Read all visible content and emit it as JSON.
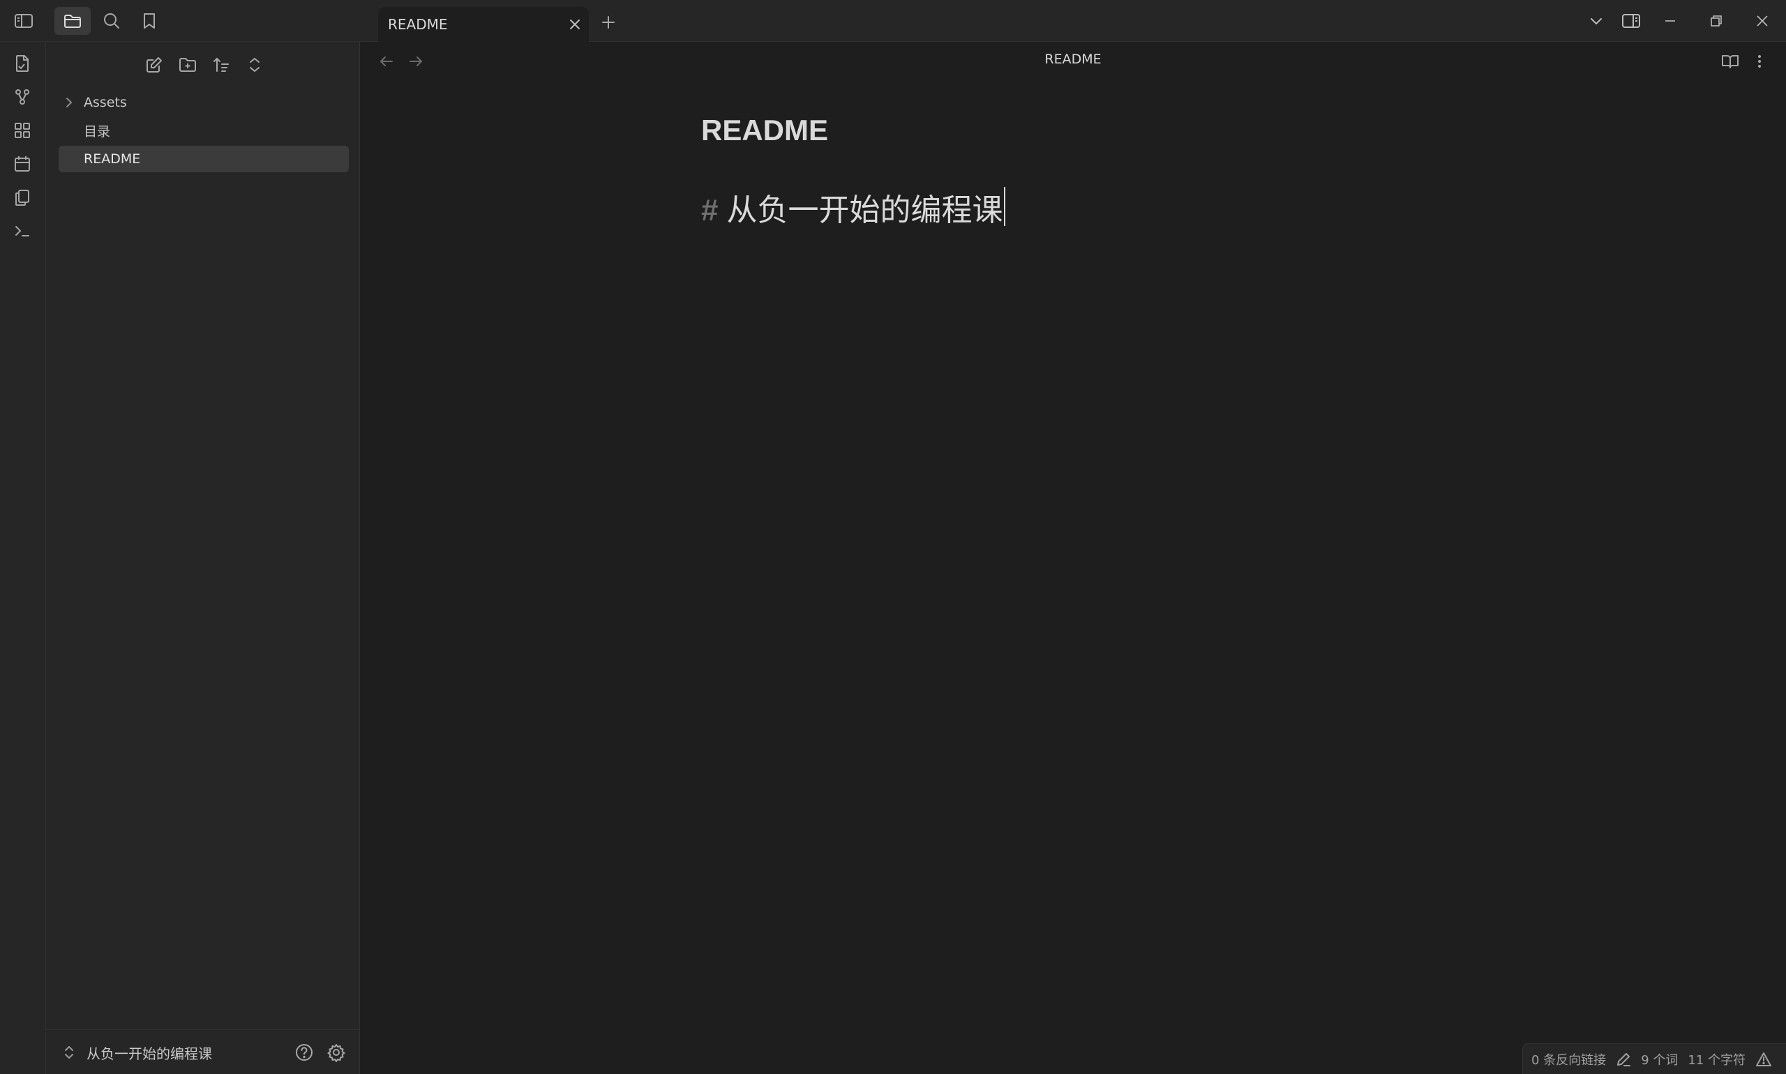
{
  "app": {
    "tab": {
      "title": "README"
    }
  },
  "sidebar": {
    "tree": [
      {
        "label": "Assets",
        "type": "folder"
      },
      {
        "label": "目录",
        "type": "file"
      },
      {
        "label": "README",
        "type": "file",
        "active": true
      }
    ],
    "vault_name": "从负一开始的编程课"
  },
  "editor": {
    "view_title": "README",
    "doc_title": "README",
    "heading_marker": "#",
    "heading_text": "从负一开始的编程课"
  },
  "statusbar": {
    "backlinks": "0 条反向链接",
    "words": "9 个词",
    "chars": "11 个字符"
  },
  "icons": {
    "titlebar": [
      "sidebar-toggle-icon",
      "folder-icon",
      "search-icon",
      "bookmark-icon"
    ],
    "ribbon": [
      "file-switcher-icon",
      "graph-icon",
      "canvas-icon",
      "calendar-icon",
      "copy-icon",
      "terminal-icon"
    ],
    "file_nav": [
      "new-note-icon",
      "new-folder-icon",
      "sort-icon",
      "collapse-all-icon"
    ],
    "window": [
      "chevron-down-icon",
      "split-pane-icon",
      "minimize-icon",
      "restore-icon",
      "close-icon"
    ]
  },
  "colors": {
    "background": "#1e1e1e",
    "panel": "#262626",
    "active_item": "#3b3b3b",
    "text": "#dadada",
    "muted": "#a8a8a8"
  }
}
